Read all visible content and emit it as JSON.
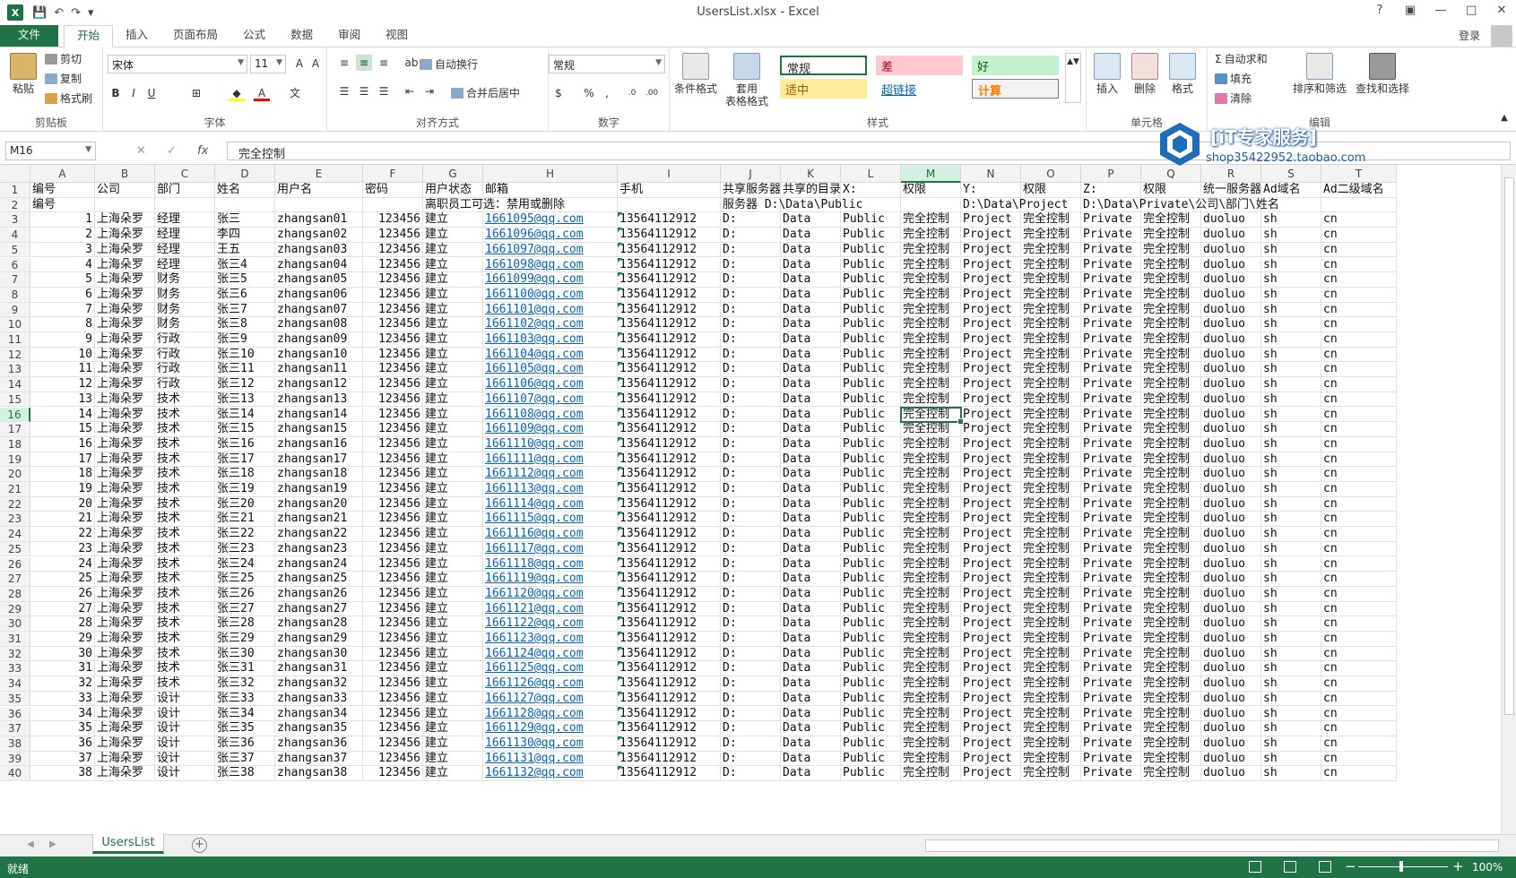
{
  "window": {
    "title": "UsersList.xlsx - Excel",
    "help": "?",
    "restore": "▣",
    "minimize": "—",
    "maximize": "□",
    "close": "✕",
    "login": "登录"
  },
  "qat": {
    "save": "💾",
    "undo": "↶",
    "redo": "↷",
    "more": "▾"
  },
  "tabs": [
    "文件",
    "开始",
    "插入",
    "页面布局",
    "公式",
    "数据",
    "审阅",
    "视图"
  ],
  "ribbon": {
    "clipboard": {
      "label": "剪贴板",
      "paste": "粘贴",
      "cut": "剪切",
      "copy": "复制",
      "painter": "格式刷"
    },
    "font": {
      "label": "字体",
      "name": "宋体",
      "size": "11",
      "bold": "B",
      "italic": "I",
      "underline": "U"
    },
    "align": {
      "label": "对齐方式",
      "wrap": "自动换行",
      "merge": "合并后居中"
    },
    "number": {
      "label": "数字",
      "format": "常规",
      "percent": "%",
      "comma": ","
    },
    "styles": {
      "label": "样式",
      "cond": "条件格式",
      "table": "套用\n表格格式",
      "normal": "常规",
      "bad": "差",
      "good": "好",
      "neutral": "适中",
      "hyperlink": "超链接",
      "calc": "计算"
    },
    "cells": {
      "label": "单元格",
      "insert": "插入",
      "delete": "删除",
      "format": "格式"
    },
    "editing": {
      "label": "编辑",
      "autosum": "自动求和",
      "fill": "填充",
      "clear": "清除",
      "sort": "排序和筛选",
      "find": "查找和选择"
    }
  },
  "watermark": {
    "title": "[iT专家服务]",
    "sub": "shop35422952.taobao.com"
  },
  "formula_bar": {
    "namebox": "M16",
    "content": "完全控制",
    "fx": "fx"
  },
  "columns": [
    "A",
    "B",
    "C",
    "D",
    "E",
    "F",
    "G",
    "H",
    "I",
    "J",
    "K",
    "L",
    "M",
    "N",
    "O",
    "P",
    "Q",
    "R",
    "S",
    "T"
  ],
  "header_rows": [
    [
      "编号",
      "公司",
      "部门",
      "姓名",
      "用户名",
      "密码",
      "用户状态",
      "邮箱",
      "手机",
      "共享服务器",
      "共享的目录",
      "X:",
      "权限",
      "Y:",
      "权限",
      "Z:",
      "权限",
      "统一服务器",
      "Ad域名",
      "Ad二级域名"
    ],
    [
      "编号",
      "",
      "",
      "",
      "",
      "",
      "离职员工可选：禁用或删除",
      "",
      "",
      "服务器 D:\\Data\\Public",
      "",
      "",
      "",
      "D:\\Data\\Project",
      "",
      "D:\\Data\\Private\\公司\\部门\\姓名",
      "",
      "",
      "",
      ""
    ]
  ],
  "rows": [
    {
      "n": "1",
      "dept": "经理",
      "name": "张三",
      "user": "zhangsan01",
      "email": "1661095@qq.com"
    },
    {
      "n": "2",
      "dept": "经理",
      "name": "李四",
      "user": "zhangsan02",
      "email": "1661096@qq.com"
    },
    {
      "n": "3",
      "dept": "经理",
      "name": "王五",
      "user": "zhangsan03",
      "email": "1661097@qq.com"
    },
    {
      "n": "4",
      "dept": "经理",
      "name": "张三4",
      "user": "zhangsan04",
      "email": "1661098@qq.com"
    },
    {
      "n": "5",
      "dept": "财务",
      "name": "张三5",
      "user": "zhangsan05",
      "email": "1661099@qq.com"
    },
    {
      "n": "6",
      "dept": "财务",
      "name": "张三6",
      "user": "zhangsan06",
      "email": "1661100@qq.com"
    },
    {
      "n": "7",
      "dept": "财务",
      "name": "张三7",
      "user": "zhangsan07",
      "email": "1661101@qq.com"
    },
    {
      "n": "8",
      "dept": "财务",
      "name": "张三8",
      "user": "zhangsan08",
      "email": "1661102@qq.com"
    },
    {
      "n": "9",
      "dept": "行政",
      "name": "张三9",
      "user": "zhangsan09",
      "email": "1661103@qq.com"
    },
    {
      "n": "10",
      "dept": "行政",
      "name": "张三10",
      "user": "zhangsan10",
      "email": "1661104@qq.com"
    },
    {
      "n": "11",
      "dept": "行政",
      "name": "张三11",
      "user": "zhangsan11",
      "email": "1661105@qq.com"
    },
    {
      "n": "12",
      "dept": "行政",
      "name": "张三12",
      "user": "zhangsan12",
      "email": "1661106@qq.com"
    },
    {
      "n": "13",
      "dept": "技术",
      "name": "张三13",
      "user": "zhangsan13",
      "email": "1661107@qq.com"
    },
    {
      "n": "14",
      "dept": "技术",
      "name": "张三14",
      "user": "zhangsan14",
      "email": "1661108@qq.com"
    },
    {
      "n": "15",
      "dept": "技术",
      "name": "张三15",
      "user": "zhangsan15",
      "email": "1661109@qq.com"
    },
    {
      "n": "16",
      "dept": "技术",
      "name": "张三16",
      "user": "zhangsan16",
      "email": "1661110@qq.com"
    },
    {
      "n": "17",
      "dept": "技术",
      "name": "张三17",
      "user": "zhangsan17",
      "email": "1661111@qq.com"
    },
    {
      "n": "18",
      "dept": "技术",
      "name": "张三18",
      "user": "zhangsan18",
      "email": "1661112@qq.com"
    },
    {
      "n": "19",
      "dept": "技术",
      "name": "张三19",
      "user": "zhangsan19",
      "email": "1661113@qq.com"
    },
    {
      "n": "20",
      "dept": "技术",
      "name": "张三20",
      "user": "zhangsan20",
      "email": "1661114@qq.com"
    },
    {
      "n": "21",
      "dept": "技术",
      "name": "张三21",
      "user": "zhangsan21",
      "email": "1661115@qq.com"
    },
    {
      "n": "22",
      "dept": "技术",
      "name": "张三22",
      "user": "zhangsan22",
      "email": "1661116@qq.com"
    },
    {
      "n": "23",
      "dept": "技术",
      "name": "张三23",
      "user": "zhangsan23",
      "email": "1661117@qq.com"
    },
    {
      "n": "24",
      "dept": "技术",
      "name": "张三24",
      "user": "zhangsan24",
      "email": "1661118@qq.com"
    },
    {
      "n": "25",
      "dept": "技术",
      "name": "张三25",
      "user": "zhangsan25",
      "email": "1661119@qq.com"
    },
    {
      "n": "26",
      "dept": "技术",
      "name": "张三26",
      "user": "zhangsan26",
      "email": "1661120@qq.com"
    },
    {
      "n": "27",
      "dept": "技术",
      "name": "张三27",
      "user": "zhangsan27",
      "email": "1661121@qq.com"
    },
    {
      "n": "28",
      "dept": "技术",
      "name": "张三28",
      "user": "zhangsan28",
      "email": "1661122@qq.com"
    },
    {
      "n": "29",
      "dept": "技术",
      "name": "张三29",
      "user": "zhangsan29",
      "email": "1661123@qq.com"
    },
    {
      "n": "30",
      "dept": "技术",
      "name": "张三30",
      "user": "zhangsan30",
      "email": "1661124@qq.com"
    },
    {
      "n": "31",
      "dept": "技术",
      "name": "张三31",
      "user": "zhangsan31",
      "email": "1661125@qq.com"
    },
    {
      "n": "32",
      "dept": "技术",
      "name": "张三32",
      "user": "zhangsan32",
      "email": "1661126@qq.com"
    },
    {
      "n": "33",
      "dept": "设计",
      "name": "张三33",
      "user": "zhangsan33",
      "email": "1661127@qq.com"
    },
    {
      "n": "34",
      "dept": "设计",
      "name": "张三34",
      "user": "zhangsan34",
      "email": "1661128@qq.com"
    },
    {
      "n": "35",
      "dept": "设计",
      "name": "张三35",
      "user": "zhangsan35",
      "email": "1661129@qq.com"
    },
    {
      "n": "36",
      "dept": "设计",
      "name": "张三36",
      "user": "zhangsan36",
      "email": "1661130@qq.com"
    },
    {
      "n": "37",
      "dept": "设计",
      "name": "张三37",
      "user": "zhangsan37",
      "email": "1661131@qq.com"
    },
    {
      "n": "38",
      "dept": "设计",
      "name": "张三38",
      "user": "zhangsan38",
      "email": "1661132@qq.com"
    }
  ],
  "row_common": {
    "company": "上海朵罗",
    "password": "123456",
    "status": "建立",
    "phone": "13564112912",
    "server": "D:",
    "dir": "Data",
    "x": "Public",
    "perm": "完全控制",
    "y": "Project",
    "z": "Private",
    "unified": "duoluo",
    "ad": "sh",
    "ad2": "cn"
  },
  "sheet": {
    "name": "UsersList",
    "add": "+"
  },
  "status": {
    "text": "就绪",
    "zoom": "100%"
  },
  "colors": {
    "accent": "#217346",
    "link": "#0563c1"
  }
}
